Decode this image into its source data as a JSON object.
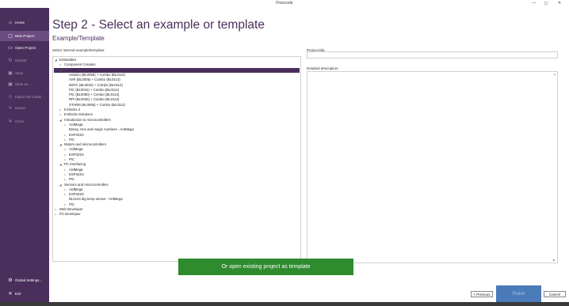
{
  "window": {
    "title": "Flowcode",
    "minimize": "—",
    "maximize": "◻",
    "close": "✕"
  },
  "sidebar": {
    "items": [
      {
        "icon": "⌂",
        "label": "Home",
        "state": "normal"
      },
      {
        "icon": "▢",
        "label": "New Project",
        "state": "active"
      },
      {
        "icon": "▭",
        "label": "Open Project",
        "state": "normal"
      },
      {
        "icon": "↻",
        "label": "Reload",
        "state": "disabled"
      },
      {
        "icon": "▣",
        "label": "Save",
        "state": "disabled"
      },
      {
        "icon": "▣",
        "label": "Save as...",
        "state": "disabled"
      },
      {
        "icon": "◇",
        "label": "Import 3D model...",
        "state": "disabled"
      },
      {
        "icon": "↳",
        "label": "Export",
        "state": "disabled"
      },
      {
        "icon": "✕",
        "label": "Close",
        "state": "disabled"
      }
    ],
    "global_settings": {
      "icon": "⚙",
      "label": "Global Settings..."
    },
    "exit": {
      "icon": "✕",
      "label": "Exit"
    }
  },
  "main": {
    "title": "Step 2 - Select an example or template",
    "subtitle": "Example/Template",
    "tree_label": "Select internal example/template:",
    "project_title_label": "Project title:",
    "description_label": "Detailed description:",
    "project_title_value": "",
    "tree": [
      {
        "label": "Embedded",
        "level": 0,
        "arrow": "◢"
      },
      {
        "label": "Component Creation",
        "level": 1,
        "arrow": "▷"
      },
      {
        "label": "",
        "level": 1,
        "arrow": "◢",
        "selected": true
      },
      {
        "label": "Arduino (BL0055) + Combo (BL0114)",
        "level": 2,
        "arrow": ""
      },
      {
        "label": "AVR (BL0006) + Combo (BL0114)",
        "level": 2,
        "arrow": ""
      },
      {
        "label": "dsPIC (BL0032) + Combo (BL0114)",
        "level": 2,
        "arrow": ""
      },
      {
        "label": "PIC (BL0011) + Combo (BL0114)",
        "level": 2,
        "arrow": ""
      },
      {
        "label": "PIC (BL0080) + Combo (BL0114)",
        "level": 2,
        "arrow": ""
      },
      {
        "label": "RPI (BL0036) + Combo (BL0114)",
        "level": 2,
        "arrow": ""
      },
      {
        "label": "STARM (BL0056) + Combo (BL0114)",
        "level": 2,
        "arrow": ""
      },
      {
        "label": "E-blocks 3",
        "level": 1,
        "arrow": "▷"
      },
      {
        "label": "E-Blocks Solutions",
        "level": 1,
        "arrow": "▷"
      },
      {
        "label": "Introduction to microcontrollers",
        "level": 1,
        "arrow": "◢"
      },
      {
        "label": "ArdMega",
        "level": 2,
        "arrow": "▷"
      },
      {
        "label": "Binary, Hex and magic numbers - ArdMega",
        "level": 2,
        "arrow": ""
      },
      {
        "label": "ESP32S3",
        "level": 2,
        "arrow": "▷"
      },
      {
        "label": "PIC",
        "level": 2,
        "arrow": "▷"
      },
      {
        "label": "Motors and microcontrollers",
        "level": 1,
        "arrow": "◢"
      },
      {
        "label": "ArdMega",
        "level": 2,
        "arrow": "▷"
      },
      {
        "label": "ESP32S3",
        "level": 2,
        "arrow": "▷"
      },
      {
        "label": "PIC",
        "level": 2,
        "arrow": "▷"
      },
      {
        "label": "PC interfacing",
        "level": 1,
        "arrow": "◢"
      },
      {
        "label": "ArdMega",
        "level": 2,
        "arrow": "▷"
      },
      {
        "label": "ESP32S3",
        "level": 2,
        "arrow": "▷"
      },
      {
        "label": "PIC",
        "level": 2,
        "arrow": "▷"
      },
      {
        "label": "Sensors and microcontrollers",
        "level": 1,
        "arrow": "◢"
      },
      {
        "label": "ArdMega",
        "level": 2,
        "arrow": "▷"
      },
      {
        "label": "ESP32S3",
        "level": 2,
        "arrow": "▷"
      },
      {
        "label": "BL0144 dig temp sensor - ArdMega",
        "level": 2,
        "arrow": ""
      },
      {
        "label": "PIC",
        "level": 2,
        "arrow": "▷"
      },
      {
        "label": "Web Developer",
        "level": 0,
        "arrow": "▷"
      },
      {
        "label": "PC Developer",
        "level": 0,
        "arrow": "▷"
      }
    ],
    "open_existing_button": "Or open existing project as template",
    "previous_button": "< Previous",
    "finish_button": "Finish",
    "cancel_button": "Cancel"
  },
  "colors": {
    "sidebar": "#4a2f5c",
    "accent": "#4a2f5c",
    "green_button": "#2e8b2e",
    "finish_button": "#4a7ab8"
  }
}
